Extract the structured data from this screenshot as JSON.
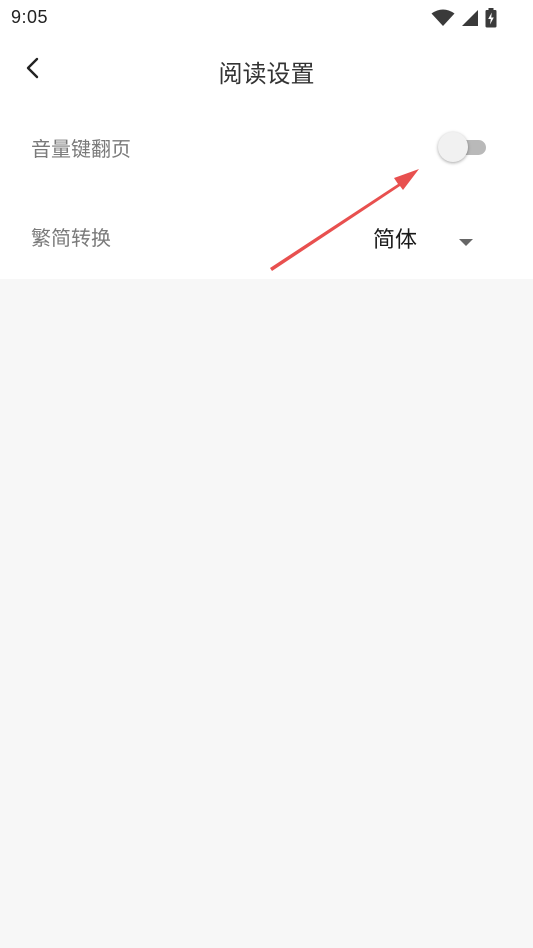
{
  "status_bar": {
    "time": "9:05",
    "icons": [
      "wifi-icon",
      "cellular-signal-icon",
      "battery-charging-icon"
    ]
  },
  "app_bar": {
    "back_icon": "chevron-left-icon",
    "title": "阅读设置"
  },
  "settings": {
    "volume_key_page_turn": {
      "label": "音量键翻页",
      "enabled": false
    },
    "traditional_simplified": {
      "label": "繁简转换",
      "selected": "简体",
      "caret_icon": "caret-down-icon"
    }
  },
  "annotation": {
    "type": "red-arrow",
    "color": "#e8504f"
  },
  "colors": {
    "page_background": "#f7f7f7",
    "panel_background": "#ffffff",
    "label_text": "#7a7a7a",
    "title_text": "#333333",
    "toggle_track_off": "#b9b9b9",
    "toggle_thumb_off": "#f1f1f1",
    "annotation_red": "#e8504f"
  }
}
